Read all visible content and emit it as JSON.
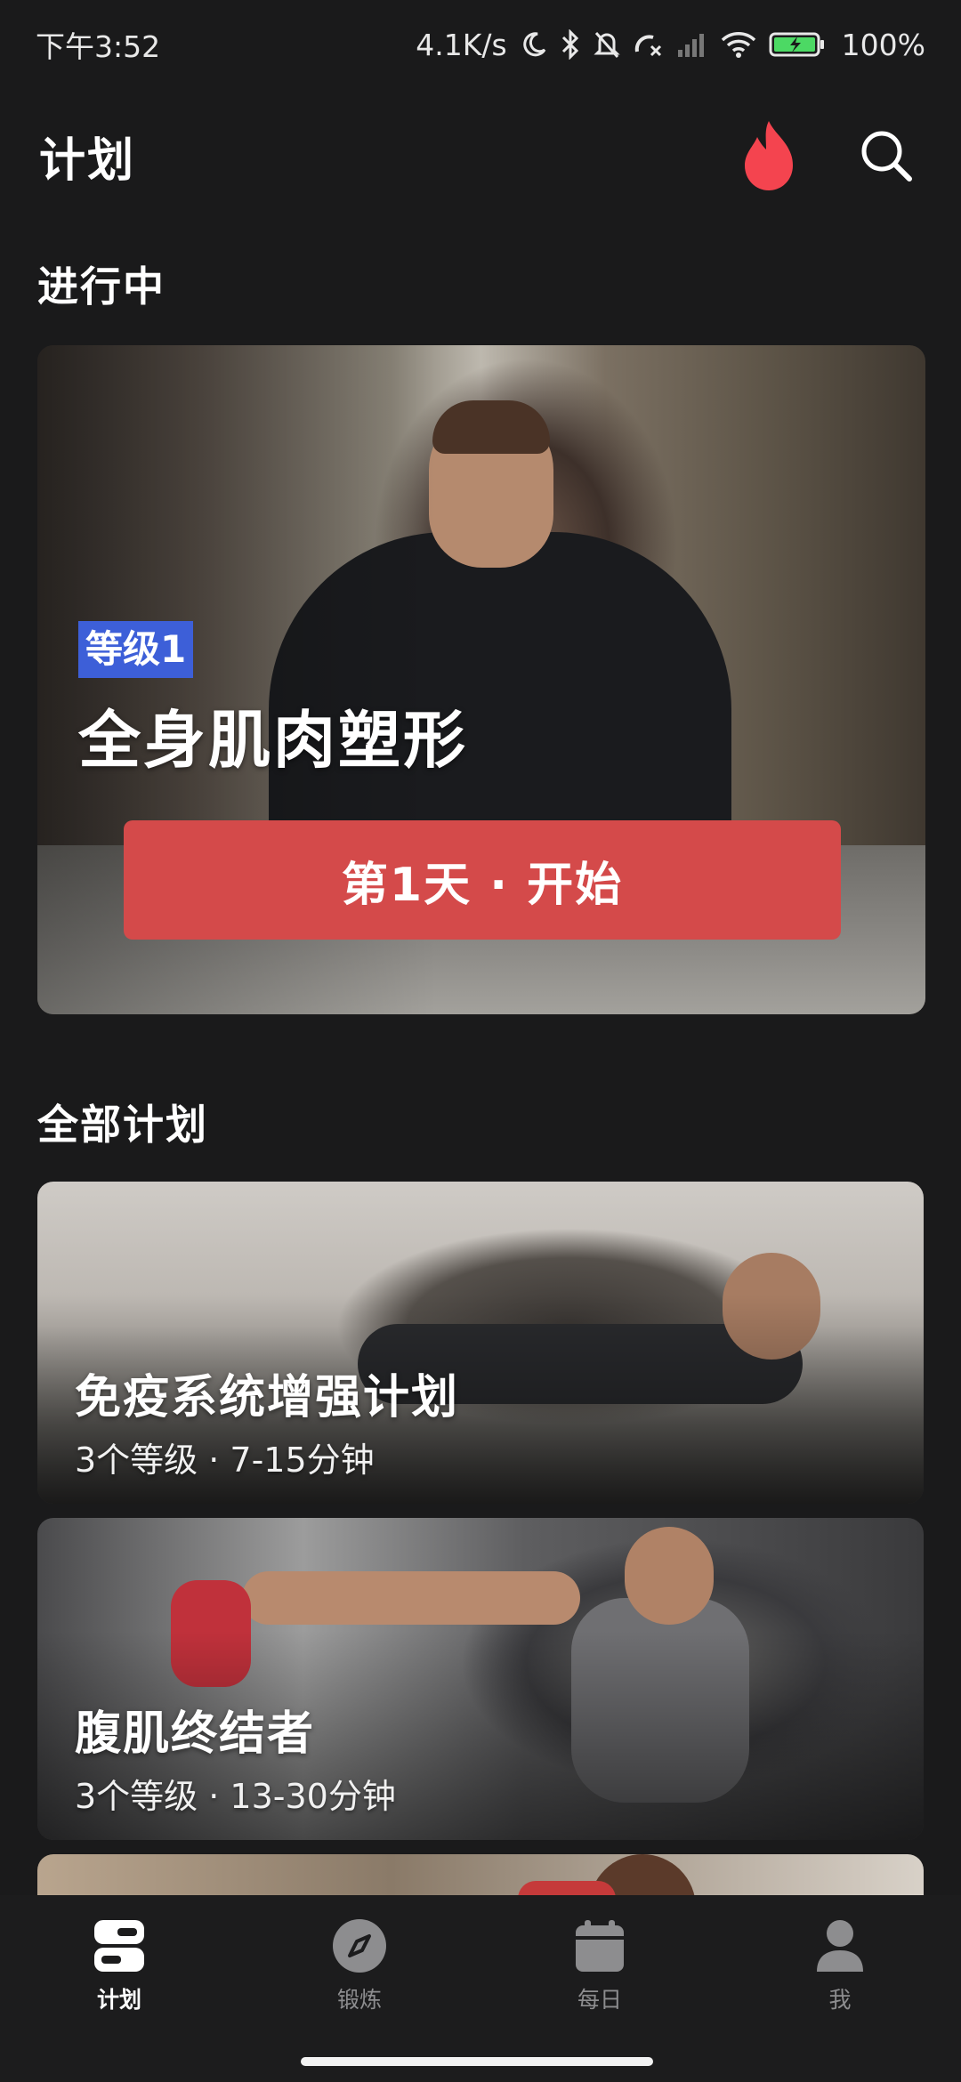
{
  "status_bar": {
    "time": "下午3:52",
    "network_speed": "4.1K/s",
    "battery": "100%",
    "icons": [
      "moon-icon",
      "bluetooth-icon",
      "mute-bell-icon",
      "call-forward-icon",
      "signal-icon",
      "wifi-icon",
      "battery-charging-icon"
    ]
  },
  "header": {
    "title": "计划",
    "streak_icon": "flame-icon",
    "search_icon": "search-icon",
    "flame_color": "#f4444f"
  },
  "in_progress": {
    "heading": "进行中",
    "card": {
      "level": "等级1",
      "title": "全身肌肉塑形",
      "button_label": "第1天 · 开始",
      "button_color": "#d44a4a",
      "badge_color": "#3d5fd8"
    }
  },
  "all_plans": {
    "heading": "全部计划",
    "items": [
      {
        "title": "免疫系统增强计划",
        "meta": "3个等级 · 7-15分钟"
      },
      {
        "title": "腹肌终结者",
        "meta": "3个等级 · 13-30分钟"
      }
    ]
  },
  "bottom_nav": {
    "items": [
      {
        "label": "计划",
        "icon": "plan-icon",
        "active": true
      },
      {
        "label": "锻炼",
        "icon": "compass-icon",
        "active": false
      },
      {
        "label": "每日",
        "icon": "calendar-icon",
        "active": false
      },
      {
        "label": "我",
        "icon": "person-icon",
        "active": false
      }
    ]
  }
}
